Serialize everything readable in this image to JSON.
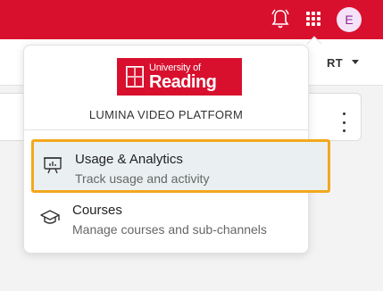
{
  "header": {
    "avatar_initial": "E",
    "icons": [
      "bell-icon",
      "apps-grid-icon"
    ]
  },
  "subbar": {
    "sort_label": "RT"
  },
  "dropdown": {
    "logo": {
      "line1": "University of",
      "line2": "Reading"
    },
    "platform_name": "LUMINA VIDEO PLATFORM",
    "items": [
      {
        "icon": "presentation-chart-icon",
        "title": "Usage & Analytics",
        "subtitle": "Track usage and activity",
        "highlighted": true
      },
      {
        "icon": "graduation-cap-icon",
        "title": "Courses",
        "subtitle": "Manage courses and sub-channels",
        "highlighted": false
      }
    ]
  },
  "colors": {
    "brand_red": "#d8102e",
    "highlight_border": "#f2a81d",
    "highlight_bg": "#eaf0f1"
  }
}
